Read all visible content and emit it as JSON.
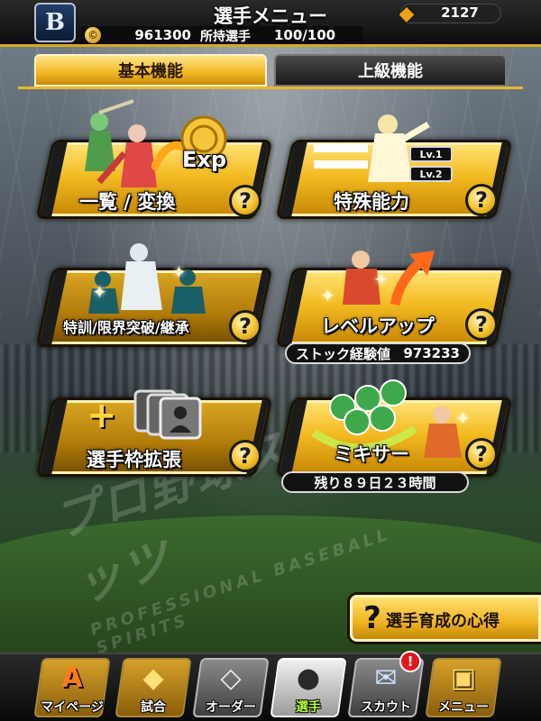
{
  "header": {
    "team_logo": "B",
    "title": "選手メニュー",
    "crystal_count": "2127",
    "money": "961300",
    "owned_label": "所持選手",
    "owned_value": "100/100",
    "coin_symbol": "©"
  },
  "tabs": [
    {
      "label": "基本機能",
      "active": true
    },
    {
      "label": "上級機能",
      "active": false
    }
  ],
  "menu": {
    "list_convert": {
      "label": "一覧 / 変換",
      "exp_text": "Exp"
    },
    "special_ability": {
      "label": "特殊能力",
      "lv1": "Lv.1",
      "lv2": "Lv.2"
    },
    "training": {
      "label": "特訓/限界突破/継承"
    },
    "level_up": {
      "label": "レベルアップ",
      "stock_label": "ストック経験値",
      "stock_value": "973233"
    },
    "expand": {
      "label": "選手枠拡張"
    },
    "mixer": {
      "label": "ミキサー",
      "remaining": "残り８９日２３時間"
    }
  },
  "help_symbol": "?",
  "background": {
    "logo_text": "プロ野球スピリッツ",
    "logo_sub": "PROFESSIONAL BASEBALL SPIRITS"
  },
  "guide": {
    "label": "選手育成の心得"
  },
  "bottom_nav": [
    {
      "label": "マイページ",
      "glyph": "A"
    },
    {
      "label": "試合",
      "glyph": "◆"
    },
    {
      "label": "オーダー",
      "glyph": "◇"
    },
    {
      "label": "選手",
      "glyph": "●"
    },
    {
      "label": "スカウト",
      "glyph": "✉"
    },
    {
      "label": "メニュー",
      "glyph": "▣"
    }
  ],
  "scout_badge": "!",
  "colors": {
    "accent_gold": "#f0b623",
    "header_line": "#d9a91e",
    "badge_red": "#e0161b",
    "active_nav_label": "#b6ff3a"
  }
}
